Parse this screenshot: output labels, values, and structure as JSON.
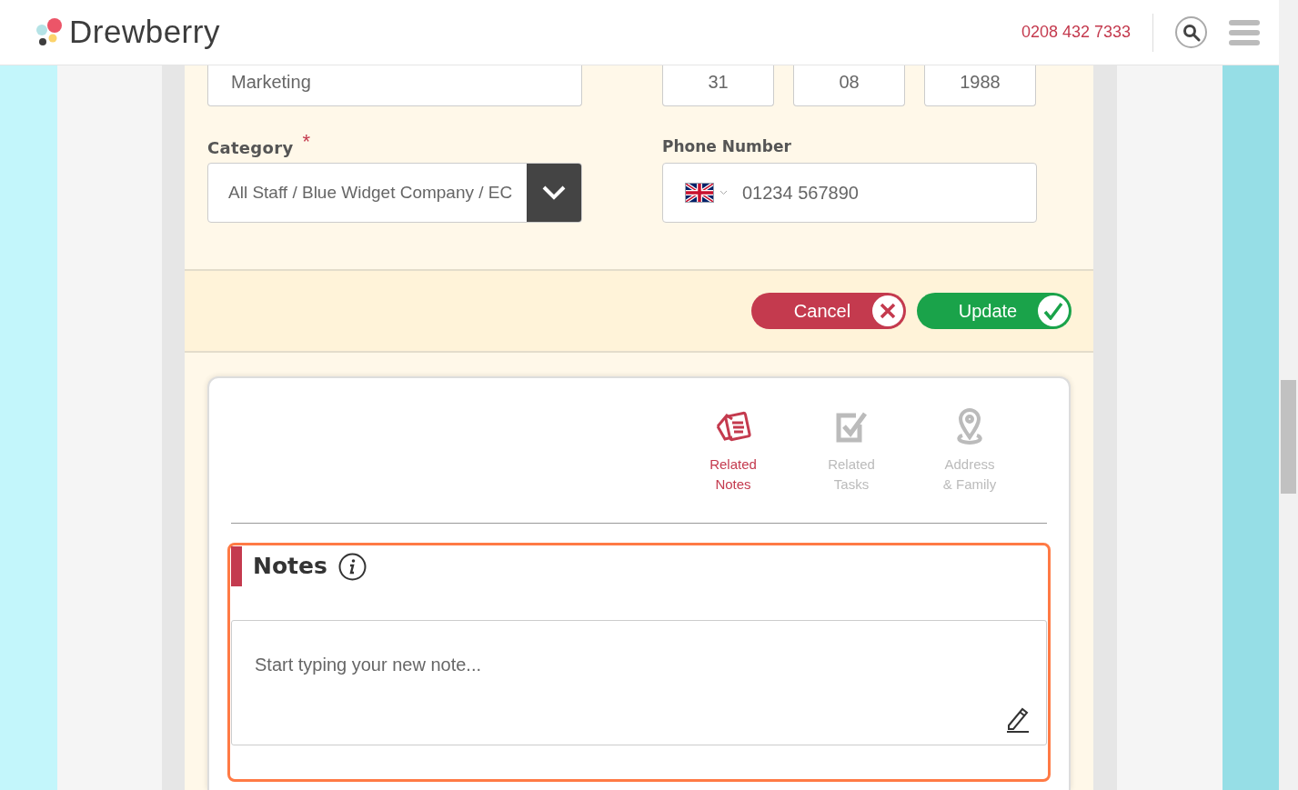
{
  "header": {
    "brand": "Drewberry",
    "phone": "0208 432 7333"
  },
  "form": {
    "department": {
      "value": "Marketing"
    },
    "birth_date": [
      {
        "value": "31"
      },
      {
        "value": "08"
      },
      {
        "value": "1988"
      }
    ],
    "category": {
      "label": "Category",
      "required_mark": "*",
      "value": "All Staff / Blue Widget Company / EC"
    },
    "phone": {
      "label": "Phone Number",
      "value": "01234 567890"
    }
  },
  "actions": [
    {
      "kind": "cancel",
      "label": "Cancel"
    },
    {
      "kind": "update",
      "label": "Update"
    }
  ],
  "tabs": [
    {
      "kind": "notes",
      "lines": [
        "Related",
        "Notes"
      ],
      "selected": true
    },
    {
      "kind": "tasks",
      "lines": [
        "Related",
        "Tasks"
      ],
      "selected": false
    },
    {
      "kind": "address",
      "lines": [
        "Address",
        "& Family"
      ],
      "selected": false
    }
  ],
  "notes": {
    "title": "Notes",
    "placeholder": "Start typing your new note..."
  }
}
